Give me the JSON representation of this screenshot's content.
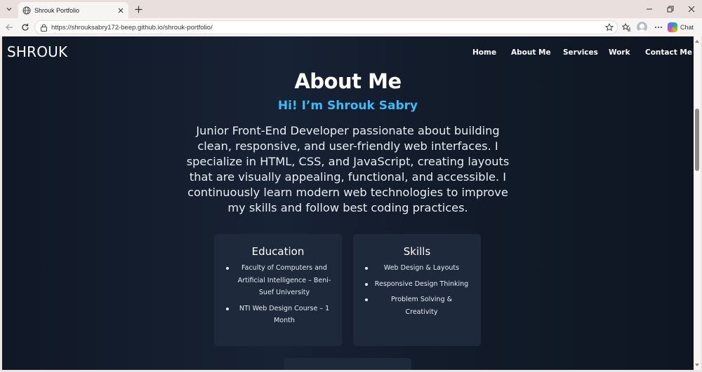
{
  "browser": {
    "tab": {
      "title": "Shrouk Portfolio",
      "favicon": "globe-icon"
    },
    "url": "https://shrouksabry172-beep.github.io/shrouk-portfolio/",
    "copilot_label": "Chat"
  },
  "page": {
    "logo": "SHROUK",
    "nav": [
      "Home",
      "About Me",
      "Services",
      "Work",
      "Contact Me"
    ],
    "heading": "About Me",
    "subheading": "Hi! I’m Shrouk Sabry",
    "intro": "Junior Front-End Developer passionate about building clean, responsive, and user-friendly web interfaces. I specialize in HTML, CSS, and JavaScript, creating layouts that are visually appealing, functional, and accessible. I continuously learn modern web technologies to improve my skills and follow best coding practices.",
    "education": {
      "title": "Education",
      "items": [
        "Faculty of Computers and Artificial Intelligence – Beni-Suef University",
        "NTI Web Design Course – 1 Month"
      ]
    },
    "skills": {
      "title": "Skills",
      "items": [
        "Web Design & Layouts",
        "Responsive Design Thinking",
        "Problem Solving & Creativity"
      ]
    }
  },
  "colors": {
    "accent": "#38bdf8",
    "page_background": "#151f2f",
    "card_background": "#1e293b",
    "text": "#ffffff"
  }
}
